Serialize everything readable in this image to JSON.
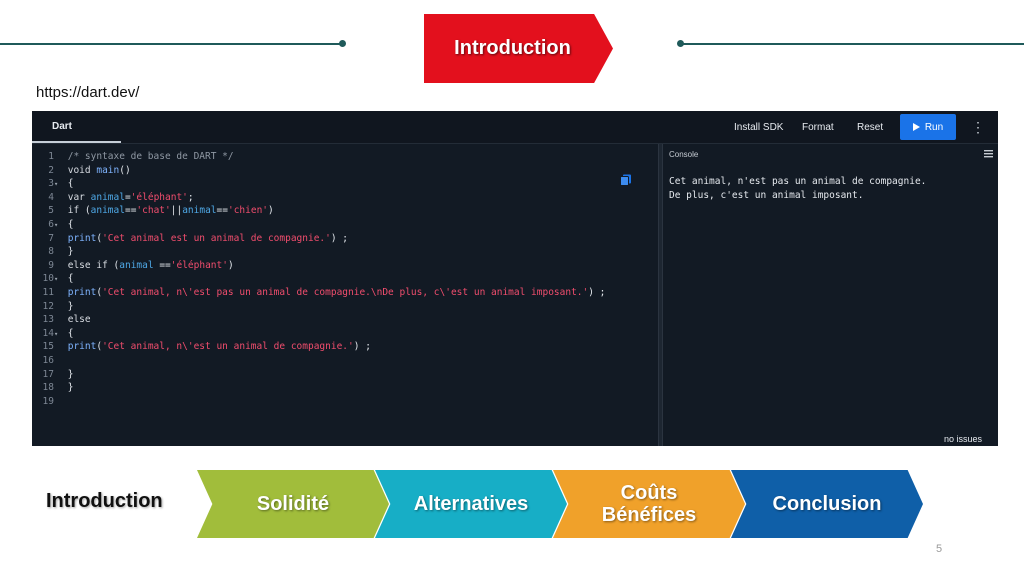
{
  "slide": {
    "title": "Introduction",
    "url": "https://dart.dev/",
    "page_number": "5"
  },
  "editor": {
    "tab_label": "Dart",
    "toolbar": {
      "install_sdk": "Install SDK",
      "format": "Format",
      "reset": "Reset",
      "run": "Run"
    },
    "code_lines": [
      {
        "n": "1",
        "fold": "",
        "text": "/* syntaxe de base de DART */"
      },
      {
        "n": "2",
        "fold": "",
        "text": "void main()"
      },
      {
        "n": "3",
        "fold": "▾",
        "text": "{"
      },
      {
        "n": "4",
        "fold": "",
        "text": "var animal='éléphant';"
      },
      {
        "n": "5",
        "fold": "",
        "text": "if (animal=='chat'||animal=='chien')"
      },
      {
        "n": "6",
        "fold": "▾",
        "text": "{"
      },
      {
        "n": "7",
        "fold": "",
        "text": "print('Cet animal est un animal de compagnie.') ;"
      },
      {
        "n": "8",
        "fold": "",
        "text": "}"
      },
      {
        "n": "9",
        "fold": "",
        "text": "else if (animal =='éléphant')"
      },
      {
        "n": "10",
        "fold": "▾",
        "text": "{"
      },
      {
        "n": "11",
        "fold": "",
        "text": "print('Cet animal, n\\'est pas un animal de compagnie.\\nDe plus, c\\'est un animal imposant.') ;"
      },
      {
        "n": "12",
        "fold": "",
        "text": "}"
      },
      {
        "n": "13",
        "fold": "",
        "text": "else"
      },
      {
        "n": "14",
        "fold": "▾",
        "text": "{"
      },
      {
        "n": "15",
        "fold": "",
        "text": "print('Cet animal, n\\'est un animal de compagnie.') ;"
      },
      {
        "n": "16",
        "fold": "",
        "text": ""
      },
      {
        "n": "17",
        "fold": "",
        "text": "}"
      },
      {
        "n": "18",
        "fold": "",
        "text": "}"
      },
      {
        "n": "19",
        "fold": "",
        "text": ""
      }
    ],
    "console": {
      "title": "Console",
      "output": [
        "Cet animal, n'est pas un animal de compagnie.",
        "De plus, c'est un animal imposant."
      ],
      "status": "no issues"
    }
  },
  "nav": {
    "current": "Introduction",
    "steps": [
      {
        "label": "Solidité",
        "color": "#a1bd3b"
      },
      {
        "label": "Alternatives",
        "color": "#17aec6"
      },
      {
        "label": "Coûts Bénéfices",
        "color": "#f0a12a"
      },
      {
        "label": "Conclusion",
        "color": "#0f5fa8"
      }
    ]
  },
  "colors": {
    "title_banner": "#e3101d",
    "run_button": "#1a73e8",
    "editor_bg": "#121a24",
    "line_accent": "#1f5a5a"
  }
}
